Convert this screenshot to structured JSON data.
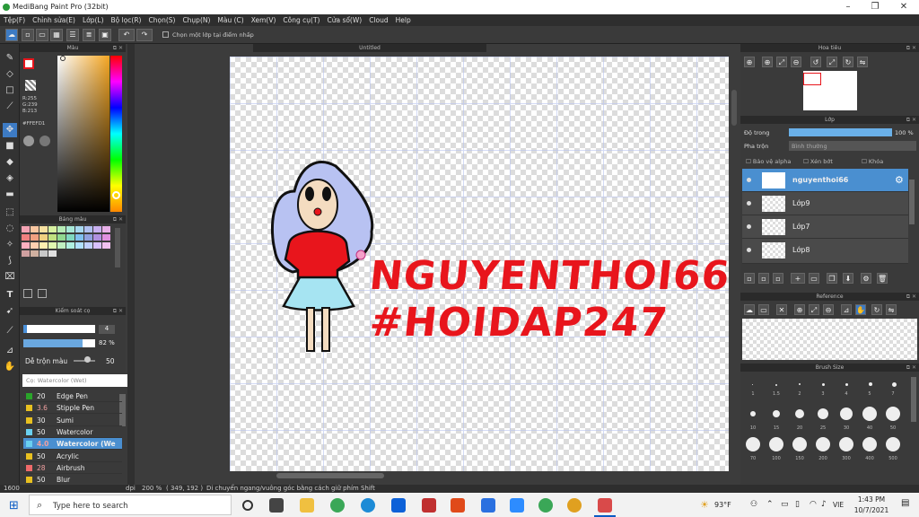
{
  "window": {
    "title": "MediBang Paint Pro (32bit)"
  },
  "menu": [
    "Tệp(F)",
    "Chỉnh sửa(E)",
    "Lớp(L)",
    "Bộ lọc(R)",
    "Chọn(S)",
    "Chụp(N)",
    "Màu (C)",
    "Xem(V)",
    "Công cụ(T)",
    "Cửa sổ(W)",
    "Cloud",
    "Help"
  ],
  "toolbar": {
    "undo": "↶",
    "redo": "↷",
    "snap_label": "Chọn một lớp tại điểm nhấp"
  },
  "color_panel": {
    "title": "Màu",
    "rgb": "R:255\nG:239\nB:213",
    "hex": "#FFEFD1"
  },
  "palette_panel": {
    "title": "Bảng màu",
    "colors": [
      "#f4a3b3",
      "#f8c6a0",
      "#f6e1a0",
      "#d7f0a0",
      "#b6ecb6",
      "#a8e8d8",
      "#a8d8f0",
      "#b0c0f0",
      "#c8b0f0",
      "#e8b0e8",
      "#f08080",
      "#f0a080",
      "#f0d080",
      "#c0e080",
      "#90d890",
      "#80d8c0",
      "#80c0f0",
      "#90a0e0",
      "#b090e0",
      "#e090e0",
      "#ffb0c0",
      "#ffd0b0",
      "#fff0b0",
      "#e0f8b0",
      "#c0f0c0",
      "#b0f0e0",
      "#b0e0ff",
      "#c0d0ff",
      "#d8c0ff",
      "#f0c0f0",
      "#d0a0a0",
      "#d0b0a0",
      "#c8c8c8",
      "#e0e0e0"
    ]
  },
  "brush_control": {
    "title": "Kiểm soát cọ",
    "size": "4",
    "opacity": "82 %",
    "mix_label": "Dễ trộn màu",
    "mix_value": "50"
  },
  "brush_list": {
    "selected": "Cọ: Watercolor (Wet)",
    "items": [
      {
        "size": "20",
        "name": "Edge Pen",
        "color": "#2aa52a"
      },
      {
        "size": "3.6",
        "name": "Stipple Pen",
        "color": "#e8c020"
      },
      {
        "size": "30",
        "name": "Sumi",
        "color": "#e8c020"
      },
      {
        "size": "50",
        "name": "Watercolor",
        "color": "#6ad0f0"
      },
      {
        "size": "4.0",
        "name": "Watercolor (We",
        "color": "#6ad0f0"
      },
      {
        "size": "50",
        "name": "Acrylic",
        "color": "#e8c020"
      },
      {
        "size": "28",
        "name": "Airbrush",
        "color": "#f06a6a"
      },
      {
        "size": "50",
        "name": "Blur",
        "color": "#e8c020"
      }
    ]
  },
  "canvas": {
    "tab": "Untitled",
    "line1": "NGUYENTHOI66",
    "line2": "#HOIDAP247"
  },
  "navigator": {
    "title": "Hoa tiêu"
  },
  "layer_panel": {
    "title": "Lớp",
    "opacity_label": "Độ trong",
    "opacity_value": "100 %",
    "blend_label": "Pha trộn",
    "blend_value": "Bình thường",
    "alpha_label": "Bảo vệ alpha",
    "clip_label": "Xén bớt",
    "lock_label": "Khóa",
    "layers": [
      "nguyenthoi66",
      "Lớp9",
      "Lớp7",
      "Lớp8"
    ]
  },
  "reference_panel": {
    "title": "Reference"
  },
  "brush_size_panel": {
    "title": "Brush Size",
    "labels_row1": [
      "1",
      "1.5",
      "2",
      "3",
      "4",
      "5",
      "7"
    ],
    "labels_row2": [
      "10",
      "15",
      "20",
      "25",
      "30",
      "40",
      "50"
    ],
    "labels_row3": [
      "70",
      "100",
      "150",
      "200",
      "300",
      "400",
      "500"
    ]
  },
  "status": {
    "zoom_left": "1600",
    "dpi": "dpi",
    "zoom": "200 %",
    "coords": "( 349, 192 )",
    "hint": "Di chuyển ngang/vuông góc bằng cách giữ phím Shift"
  },
  "taskbar": {
    "search": "Type here to search",
    "weather": "93°F",
    "lang": "VIE",
    "time": "1:43 PM",
    "date": "10/7/2021"
  }
}
